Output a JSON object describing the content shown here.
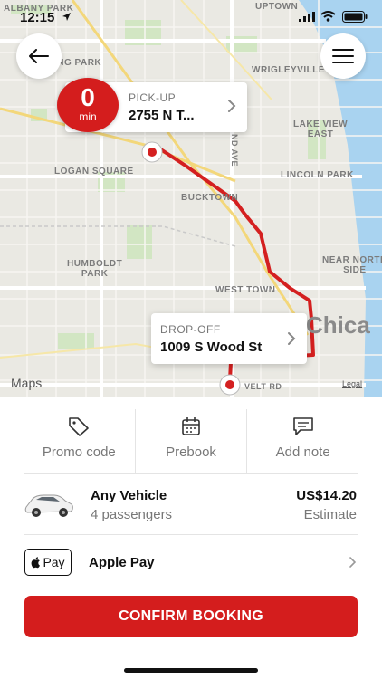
{
  "status_bar": {
    "time": "12:15"
  },
  "map": {
    "labels": {
      "albany_park": "ALBANY PARK",
      "uptown": "UPTOWN",
      "ing_park": "ING PARK",
      "wrigleyville": "WRIGLEYVILLE",
      "lake_view_east": "LAKE VIEW\nEAST",
      "logan_square": "LOGAN SQUARE",
      "lincoln_park": "LINCOLN PARK",
      "bucktown": "BUCKTOWN",
      "humboldt_park": "HUMBOLDT\nPARK",
      "near_north_side": "NEAR NORTH\nSIDE",
      "west_town": "WEST TOWN",
      "nd_ave": "ND AVE",
      "roosevelt_rd": "VELT RD",
      "city": "Chica"
    },
    "maps_logo": "Maps",
    "legal": "Legal"
  },
  "pickup": {
    "label": "PICK-UP",
    "address": "2755 N T...",
    "eta_value": "0",
    "eta_unit": "min"
  },
  "dropoff": {
    "label": "DROP-OFF",
    "address": "1009 S Wood St"
  },
  "actions": [
    {
      "label": "Promo code",
      "icon": "tag-icon"
    },
    {
      "label": "Prebook",
      "icon": "calendar-icon"
    },
    {
      "label": "Add note",
      "icon": "message-icon"
    }
  ],
  "vehicle": {
    "name": "Any Vehicle",
    "passengers": "4 passengers",
    "price": "US$14.20",
    "price_note": "Estimate"
  },
  "payment": {
    "badge": "Pay",
    "name": "Apple Pay"
  },
  "confirm_label": "CONFIRM BOOKING",
  "colors": {
    "brand_red": "#d41d1d",
    "route_red": "#d42020",
    "water": "#a9d3f0",
    "park": "#d2e6c3"
  }
}
